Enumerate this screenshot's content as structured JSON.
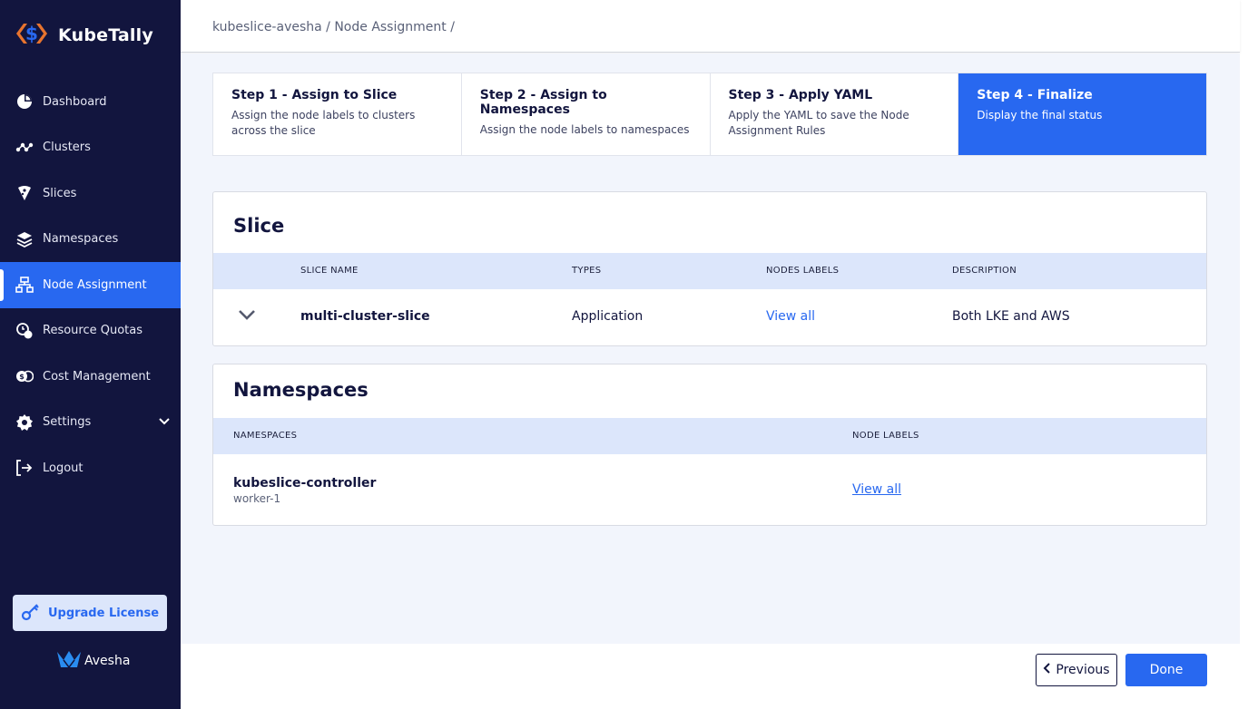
{
  "brand": {
    "name": "KubeTally",
    "logo_icon": "dollar-logo-icon"
  },
  "sidebar": {
    "items": [
      {
        "label": "Dashboard",
        "icon": "pie-chart-icon"
      },
      {
        "label": "Clusters",
        "icon": "cluster-graph-icon"
      },
      {
        "label": "Slices",
        "icon": "slice-icon"
      },
      {
        "label": "Namespaces",
        "icon": "layers-icon"
      },
      {
        "label": "Node Assignment",
        "icon": "hierarchy-icon",
        "active": true
      },
      {
        "label": "Resource Quotas",
        "icon": "quota-icon"
      },
      {
        "label": "Cost Management",
        "icon": "coins-icon"
      },
      {
        "label": "Settings",
        "icon": "gear-icon"
      },
      {
        "label": "Logout",
        "icon": "logout-icon"
      }
    ],
    "upgrade_label": "Upgrade License",
    "vendor": "Avesha"
  },
  "breadcrumb": "kubeslice-avesha / Node Assignment /",
  "steps": [
    {
      "title": "Step 1 - Assign to Slice",
      "desc": "Assign the node labels to clusters across the slice"
    },
    {
      "title": "Step 2 - Assign to Namespaces",
      "desc": "Assign the node labels to namespaces"
    },
    {
      "title": "Step 3 - Apply YAML",
      "desc": "Apply the YAML to save the Node Assignment Rules"
    },
    {
      "title": "Step 4 - Finalize",
      "desc": "Display the final status",
      "active": true
    }
  ],
  "slice_card": {
    "title": "Slice",
    "headers": [
      "SLICE NAME",
      "TYPES",
      "NODES LABELS",
      "DESCRIPTION"
    ],
    "row": {
      "name": "multi-cluster-slice",
      "type": "Application",
      "labels_link": "View all",
      "description": "Both LKE and AWS"
    }
  },
  "ns_card": {
    "title": "Namespaces",
    "headers": [
      "NAMESPACES",
      "NODE LABELS"
    ],
    "row": {
      "namespace": "kubeslice-controller",
      "cluster": "worker-1",
      "labels_link": "View all"
    }
  },
  "footer": {
    "previous": "Previous",
    "done": "Done"
  },
  "colors": {
    "sidebar": "#12153e",
    "accent": "#2868f0",
    "header_row": "#dce6fb"
  }
}
